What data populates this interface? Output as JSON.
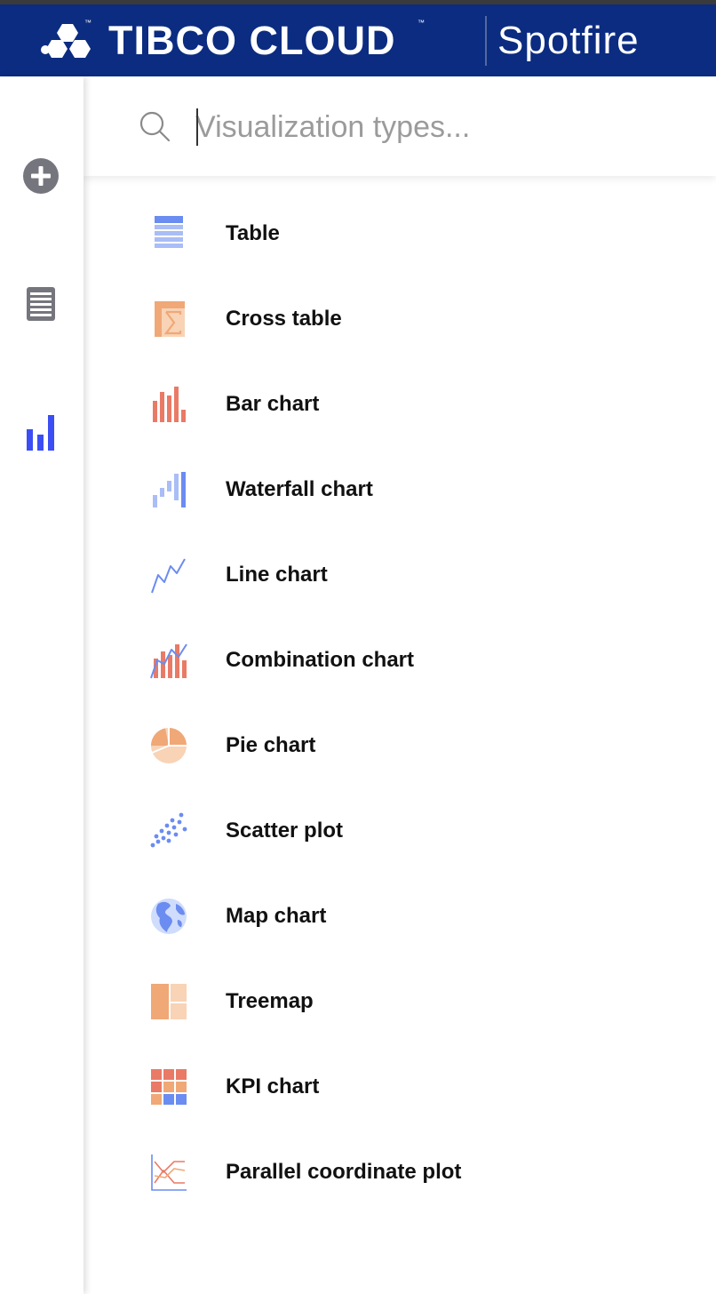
{
  "header": {
    "brand": "TIBCO CLOUD",
    "trademark": "™",
    "product": "Spotfire",
    "background_color": "#0b2c80"
  },
  "rail": {
    "items": [
      {
        "name": "add-icon",
        "active": false
      },
      {
        "name": "data-table-icon",
        "active": false
      },
      {
        "name": "visualizations-icon",
        "active": true
      }
    ],
    "active_color": "#3b4ef5",
    "inactive_color": "#75757d"
  },
  "search": {
    "placeholder": "Visualization types...",
    "value": "",
    "icon": "search-icon"
  },
  "visualizations": [
    {
      "label": "Table",
      "icon": "table-icon"
    },
    {
      "label": "Cross table",
      "icon": "cross-table-icon"
    },
    {
      "label": "Bar chart",
      "icon": "bar-chart-icon"
    },
    {
      "label": "Waterfall chart",
      "icon": "waterfall-chart-icon"
    },
    {
      "label": "Line chart",
      "icon": "line-chart-icon"
    },
    {
      "label": "Combination chart",
      "icon": "combination-chart-icon"
    },
    {
      "label": "Pie chart",
      "icon": "pie-chart-icon"
    },
    {
      "label": "Scatter plot",
      "icon": "scatter-plot-icon"
    },
    {
      "label": "Map chart",
      "icon": "map-chart-icon"
    },
    {
      "label": "Treemap",
      "icon": "treemap-icon"
    },
    {
      "label": "KPI chart",
      "icon": "kpi-chart-icon"
    },
    {
      "label": "Parallel coordinate plot",
      "icon": "parallel-coordinate-plot-icon"
    }
  ],
  "colors": {
    "blue": "#6b8cf0",
    "light_blue": "#a9bdf6",
    "red": "#e97a66",
    "orange": "#f0a877",
    "light_orange": "#f8d3b6"
  }
}
